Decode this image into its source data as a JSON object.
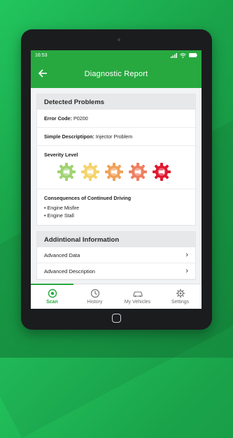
{
  "status_bar": {
    "time": "16:53"
  },
  "header": {
    "title": "Diagnostic Report"
  },
  "detected_problems": {
    "title": "Detected Problems",
    "error_code_label": "Error Code:",
    "error_code_value": "P0200",
    "description_label": "Simple Descriptipon:",
    "description_value": "Injector Problem",
    "severity_label": "Severity Level",
    "severity_colors": [
      "#9fd36f",
      "#f4d36b",
      "#f2a15a",
      "#ee7f5f",
      "#e0182e"
    ],
    "consequences_label": "Consequences of Continued Driving",
    "consequences": [
      "• Engine Misfire",
      "• Engine Stall"
    ]
  },
  "additional_info": {
    "title": "Addintional Information",
    "items": [
      "Advanced Data",
      "Advanced Description"
    ]
  },
  "bottom_nav": {
    "items": [
      {
        "label": "Scan",
        "icon": "scan-icon",
        "active": true
      },
      {
        "label": "History",
        "icon": "history-icon",
        "active": false
      },
      {
        "label": "My Vehicles",
        "icon": "car-icon",
        "active": false
      },
      {
        "label": "Settings",
        "icon": "gear-icon",
        "active": false
      }
    ]
  }
}
